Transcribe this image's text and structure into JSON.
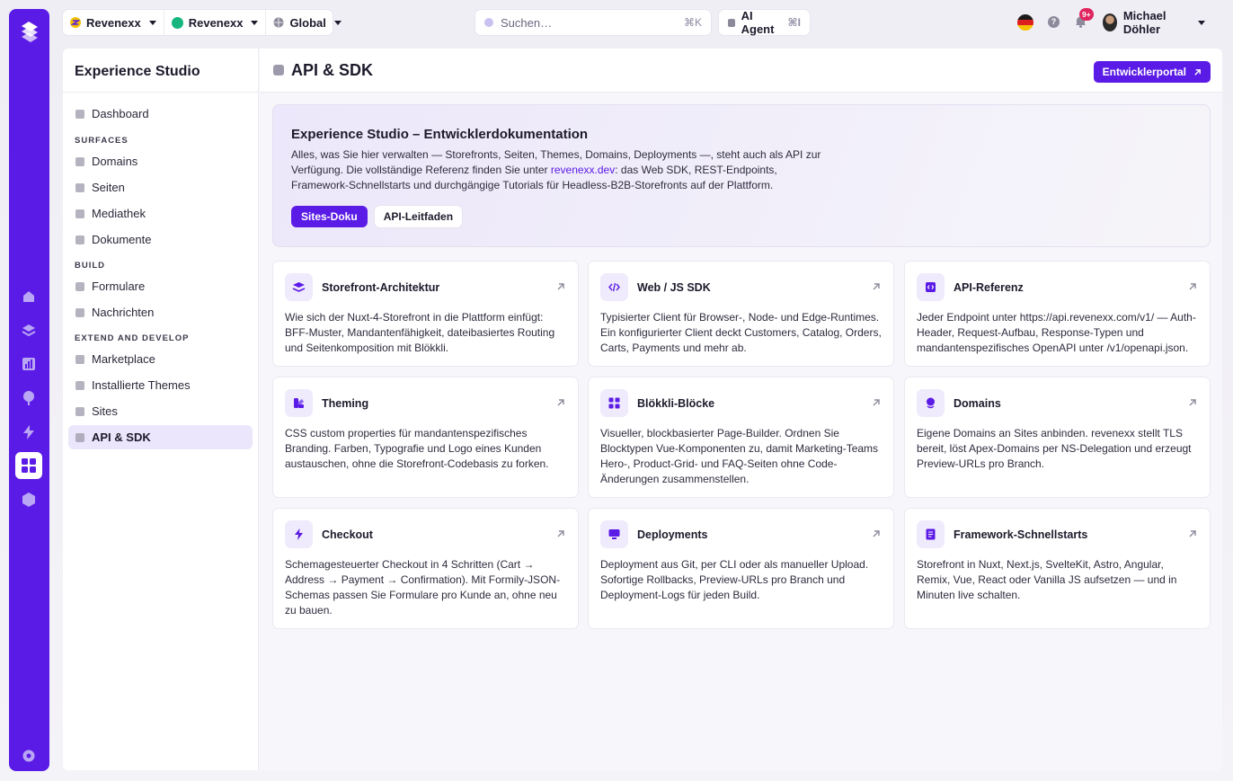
{
  "topbar": {
    "org": "Revenexx",
    "project": "Revenexx",
    "region": "Global",
    "search_placeholder": "Suchen…",
    "search_shortcut": "⌘K",
    "ai_agent": "AI Agent",
    "ai_shortcut": "⌘I",
    "notification_count": "9+",
    "user_name": "Michael Döhler"
  },
  "sidebar": {
    "title": "Experience Studio",
    "dashboard": "Dashboard",
    "section_surfaces": "SURFACES",
    "domains": "Domains",
    "seiten": "Seiten",
    "mediathek": "Mediathek",
    "dokumente": "Dokumente",
    "section_build": "BUILD",
    "formulare": "Formulare",
    "nachrichten": "Nachrichten",
    "section_extend": "EXTEND AND DEVELOP",
    "marketplace": "Marketplace",
    "themes": "Installierte Themes",
    "sites": "Sites",
    "api_sdk": "API & SDK"
  },
  "page": {
    "title": "API & SDK",
    "dev_portal": "Entwicklerportal"
  },
  "hero": {
    "title": "Experience Studio – Entwicklerdokumentation",
    "text_before": "Alles, was Sie hier verwalten — Storefronts, Seiten, Themes, Domains, Deployments —, steht auch als API zur Verfügung. Die vollständige Referenz finden Sie unter ",
    "link": "revenexx.dev",
    "text_after": ": das Web SDK, REST-Endpoints, Framework-Schnellstarts und durchgängige Tutorials für Headless-B2B-Storefronts auf der Plattform.",
    "btn_primary": "Sites-Doku",
    "btn_secondary": "API-Leitfaden"
  },
  "cards": [
    {
      "title": "Storefront-Architektur",
      "text": "Wie sich der Nuxt-4-Storefront in die Plattform einfügt: BFF-Muster, Mandantenfähigkeit, dateibasiertes Routing und Seitenkomposition mit Blökkli."
    },
    {
      "title": "Web / JS SDK",
      "text": "Typisierter Client für Browser-, Node- und Edge-Runtimes. Ein konfigurierter Client deckt Customers, Catalog, Orders, Carts, Payments und mehr ab."
    },
    {
      "title": "API-Referenz",
      "text": "Jeder Endpoint unter https://api.revenexx.com/v1/ — Auth-Header, Request-Aufbau, Response-Typen und mandantenspezifisches OpenAPI unter /v1/openapi.json."
    },
    {
      "title": "Theming",
      "text": "CSS custom properties für mandantenspezifisches Branding. Farben, Typografie und Logo eines Kunden austauschen, ohne die Storefront-Codebasis zu forken."
    },
    {
      "title": "Blökkli-Blöcke",
      "text": "Visueller, blockbasierter Page-Builder. Ordnen Sie Blocktypen Vue-Komponenten zu, damit Marketing-Teams Hero-, Product-Grid- und FAQ-Seiten ohne Code-Änderungen zusammenstellen."
    },
    {
      "title": "Domains",
      "text": "Eigene Domains an Sites anbinden. revenexx stellt TLS bereit, löst Apex-Domains per NS-Delegation und erzeugt Preview-URLs pro Branch."
    },
    {
      "title": "Checkout",
      "text": "Schemagesteuerter Checkout in 4 Schritten (Cart → Address → Payment → Confirmation). Mit Formily-JSON-Schemas passen Sie Formulare pro Kunde an, ohne neu zu bauen."
    },
    {
      "title": "Deployments",
      "text": "Deployment aus Git, per CLI oder als manueller Upload. Sofortige Rollbacks, Preview-URLs pro Branch und Deployment-Logs für jeden Build."
    },
    {
      "title": "Framework-Schnellstarts",
      "text": "Storefront in Nuxt, Next.js, SvelteKit, Astro, Angular, Remix, Vue, React oder Vanilla JS aufsetzen — und in Minuten live schalten."
    }
  ],
  "colors": {
    "brand": "#5b1be6",
    "active_bg": "#ebe6fb",
    "icon_bg": "#efeafc"
  }
}
